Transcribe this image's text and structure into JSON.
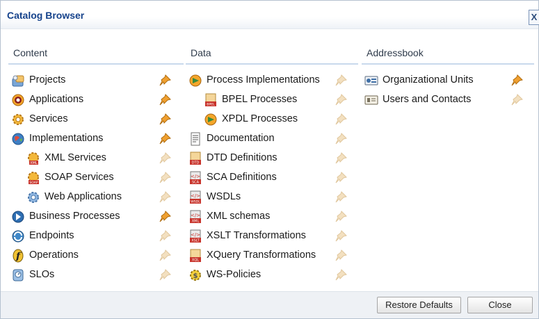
{
  "window": {
    "title": "Catalog Browser",
    "close_glyph": "X"
  },
  "columns": [
    {
      "header": "Content",
      "items": [
        {
          "label": "Projects",
          "icon": "projects-icon",
          "indent": 0,
          "pinned": true
        },
        {
          "label": "Applications",
          "icon": "applications-icon",
          "indent": 0,
          "pinned": true
        },
        {
          "label": "Services",
          "icon": "services-icon",
          "indent": 0,
          "pinned": true
        },
        {
          "label": "Implementations",
          "icon": "implementations-icon",
          "indent": 0,
          "pinned": true
        },
        {
          "label": "XML Services",
          "icon": "xml-services-icon",
          "indent": 1,
          "pinned": false
        },
        {
          "label": "SOAP Services",
          "icon": "soap-services-icon",
          "indent": 1,
          "pinned": false
        },
        {
          "label": "Web Applications",
          "icon": "web-applications-icon",
          "indent": 1,
          "pinned": false
        },
        {
          "label": "Business Processes",
          "icon": "business-processes-icon",
          "indent": 0,
          "pinned": true
        },
        {
          "label": "Endpoints",
          "icon": "endpoints-icon",
          "indent": 0,
          "pinned": false
        },
        {
          "label": "Operations",
          "icon": "operations-icon",
          "indent": 0,
          "pinned": false
        },
        {
          "label": "SLOs",
          "icon": "slos-icon",
          "indent": 0,
          "pinned": false
        }
      ]
    },
    {
      "header": "Data",
      "items": [
        {
          "label": "Process Implementations",
          "icon": "process-implementations-icon",
          "indent": 0,
          "pinned": false
        },
        {
          "label": "BPEL Processes",
          "icon": "bpel-processes-icon",
          "indent": 1,
          "pinned": false
        },
        {
          "label": "XPDL Processes",
          "icon": "xpdl-processes-icon",
          "indent": 1,
          "pinned": false
        },
        {
          "label": "Documentation",
          "icon": "documentation-icon",
          "indent": 0,
          "pinned": false
        },
        {
          "label": "DTD Definitions",
          "icon": "dtd-definitions-icon",
          "indent": 0,
          "pinned": false
        },
        {
          "label": "SCA Definitions",
          "icon": "sca-definitions-icon",
          "indent": 0,
          "pinned": false
        },
        {
          "label": "WSDLs",
          "icon": "wsdls-icon",
          "indent": 0,
          "pinned": false
        },
        {
          "label": "XML schemas",
          "icon": "xml-schemas-icon",
          "indent": 0,
          "pinned": false
        },
        {
          "label": "XSLT Transformations",
          "icon": "xslt-transformations-icon",
          "indent": 0,
          "pinned": false
        },
        {
          "label": "XQuery Transformations",
          "icon": "xquery-transformations-icon",
          "indent": 0,
          "pinned": false
        },
        {
          "label": "WS-Policies",
          "icon": "ws-policies-icon",
          "indent": 0,
          "pinned": false
        }
      ]
    },
    {
      "header": "Addressbook",
      "items": [
        {
          "label": "Organizational Units",
          "icon": "organizational-units-icon",
          "indent": 0,
          "pinned": true
        },
        {
          "label": "Users and Contacts",
          "icon": "users-and-contacts-icon",
          "indent": 0,
          "pinned": false
        }
      ]
    }
  ],
  "footer": {
    "restore_label": "Restore Defaults",
    "close_label": "Close"
  },
  "colors": {
    "pinned": "#f0a030",
    "unpinned": "#f3e0c0",
    "title": "#15428b"
  }
}
